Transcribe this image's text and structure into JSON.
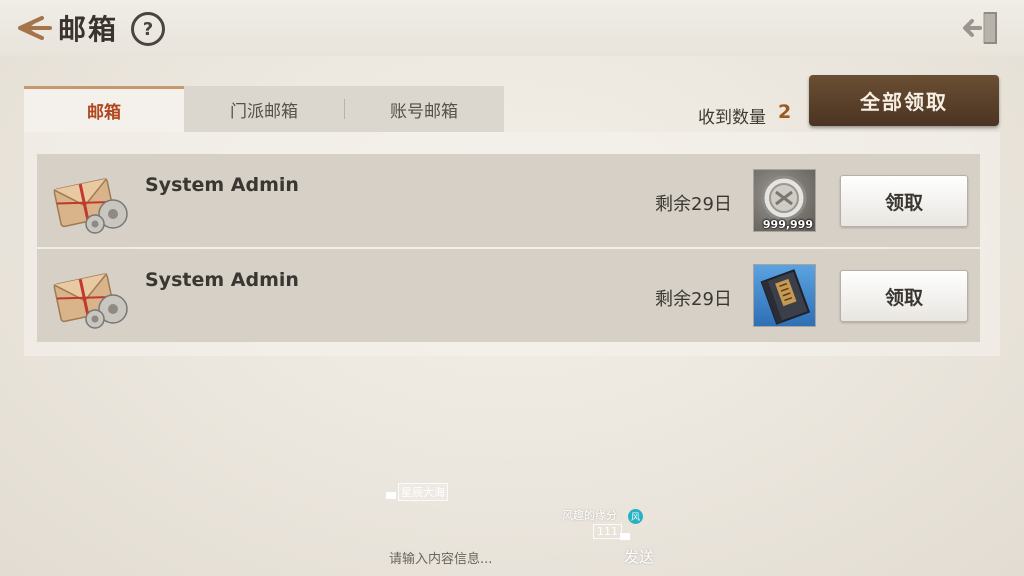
{
  "header": {
    "title": "邮箱",
    "help_glyph": "?",
    "back_icon": "back-arrow-icon",
    "exit_icon": "exit-door-icon"
  },
  "tabs": [
    {
      "label": "邮箱",
      "active": true
    },
    {
      "label": "门派邮箱",
      "active": false
    },
    {
      "label": "账号邮箱",
      "active": false
    }
  ],
  "received": {
    "label": "收到数量",
    "count": "2"
  },
  "claim_all_label": "全部领取",
  "mails": [
    {
      "sender": "System Admin",
      "days_left": "剩余29日",
      "item_icon": "silver-coin-icon",
      "item_qty": "999,999",
      "claim_label": "领取"
    },
    {
      "sender": "System Admin",
      "days_left": "剩余29日",
      "item_icon": "book-icon",
      "item_qty": "",
      "claim_label": "领取"
    }
  ],
  "chat": {
    "channel": "星辰大海",
    "player_name": "风趣的缘分",
    "badge": "风",
    "level": "111",
    "input_placeholder": "请输入内容信息...",
    "send_label": "发送"
  },
  "colors": {
    "accent_brown": "#5a4029",
    "active_tab_text": "#b0471e",
    "count_color": "#9a5a20"
  }
}
